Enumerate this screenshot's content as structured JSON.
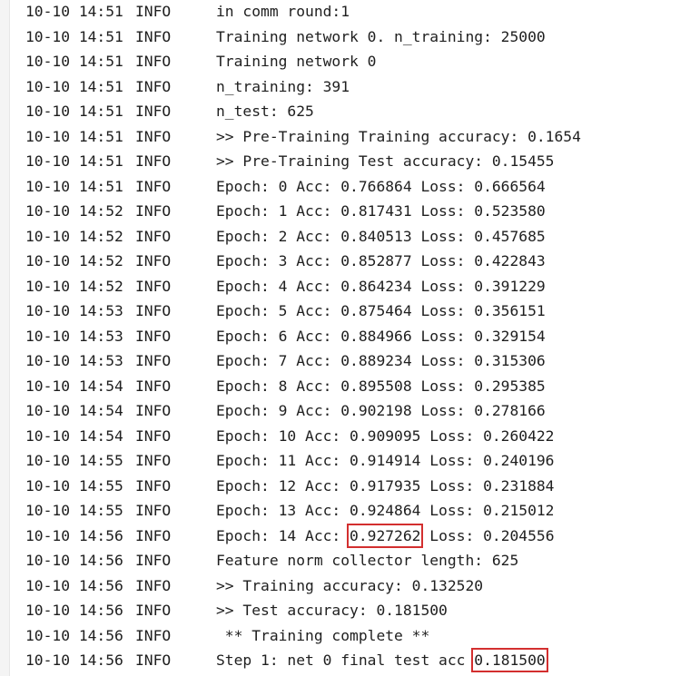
{
  "log": {
    "lines": [
      {
        "ts": "10-10 14:51",
        "level": "INFO",
        "msg": "in comm round:1"
      },
      {
        "ts": "10-10 14:51",
        "level": "INFO",
        "msg": "Training network 0. n_training: 25000"
      },
      {
        "ts": "10-10 14:51",
        "level": "INFO",
        "msg": "Training network 0"
      },
      {
        "ts": "10-10 14:51",
        "level": "INFO",
        "msg": "n_training: 391"
      },
      {
        "ts": "10-10 14:51",
        "level": "INFO",
        "msg": "n_test: 625"
      },
      {
        "ts": "10-10 14:51",
        "level": "INFO",
        "msg": ">> Pre-Training Training accuracy: 0.1654"
      },
      {
        "ts": "10-10 14:51",
        "level": "INFO",
        "msg": ">> Pre-Training Test accuracy: 0.15455"
      },
      {
        "ts": "10-10 14:51",
        "level": "INFO",
        "msg": "Epoch: 0 Acc: 0.766864 Loss: 0.666564"
      },
      {
        "ts": "10-10 14:52",
        "level": "INFO",
        "msg": "Epoch: 1 Acc: 0.817431 Loss: 0.523580"
      },
      {
        "ts": "10-10 14:52",
        "level": "INFO",
        "msg": "Epoch: 2 Acc: 0.840513 Loss: 0.457685"
      },
      {
        "ts": "10-10 14:52",
        "level": "INFO",
        "msg": "Epoch: 3 Acc: 0.852877 Loss: 0.422843"
      },
      {
        "ts": "10-10 14:52",
        "level": "INFO",
        "msg": "Epoch: 4 Acc: 0.864234 Loss: 0.391229"
      },
      {
        "ts": "10-10 14:53",
        "level": "INFO",
        "msg": "Epoch: 5 Acc: 0.875464 Loss: 0.356151"
      },
      {
        "ts": "10-10 14:53",
        "level": "INFO",
        "msg": "Epoch: 6 Acc: 0.884966 Loss: 0.329154"
      },
      {
        "ts": "10-10 14:53",
        "level": "INFO",
        "msg": "Epoch: 7 Acc: 0.889234 Loss: 0.315306"
      },
      {
        "ts": "10-10 14:54",
        "level": "INFO",
        "msg": "Epoch: 8 Acc: 0.895508 Loss: 0.295385"
      },
      {
        "ts": "10-10 14:54",
        "level": "INFO",
        "msg": "Epoch: 9 Acc: 0.902198 Loss: 0.278166"
      },
      {
        "ts": "10-10 14:54",
        "level": "INFO",
        "msg": "Epoch: 10 Acc: 0.909095 Loss: 0.260422"
      },
      {
        "ts": "10-10 14:55",
        "level": "INFO",
        "msg": "Epoch: 11 Acc: 0.914914 Loss: 0.240196"
      },
      {
        "ts": "10-10 14:55",
        "level": "INFO",
        "msg": "Epoch: 12 Acc: 0.917935 Loss: 0.231884"
      },
      {
        "ts": "10-10 14:55",
        "level": "INFO",
        "msg": "Epoch: 13 Acc: 0.924864 Loss: 0.215012"
      },
      {
        "ts": "10-10 14:56",
        "level": "INFO",
        "msg_pre": "Epoch: 14 Acc:",
        "msg_hl": "0.927262",
        "msg_post": "Loss: 0.204556"
      },
      {
        "ts": "10-10 14:56",
        "level": "INFO",
        "msg": "Feature norm collector length: 625"
      },
      {
        "ts": "10-10 14:56",
        "level": "INFO",
        "msg": ">> Training accuracy: 0.132520"
      },
      {
        "ts": "10-10 14:56",
        "level": "INFO",
        "msg": ">> Test accuracy: 0.181500"
      },
      {
        "ts": "10-10 14:56",
        "level": "INFO",
        "msg": " ** Training complete **"
      },
      {
        "ts": "10-10 14:56",
        "level": "INFO",
        "msg_pre": "Step 1: net 0 final test acc",
        "msg_hl": "0.181500",
        "msg_post": ""
      }
    ]
  },
  "colors": {
    "text": "#1f1f1f",
    "highlight_box": "#d32f2f",
    "background": "#ffffff",
    "gutter": "#f4f4f4"
  }
}
